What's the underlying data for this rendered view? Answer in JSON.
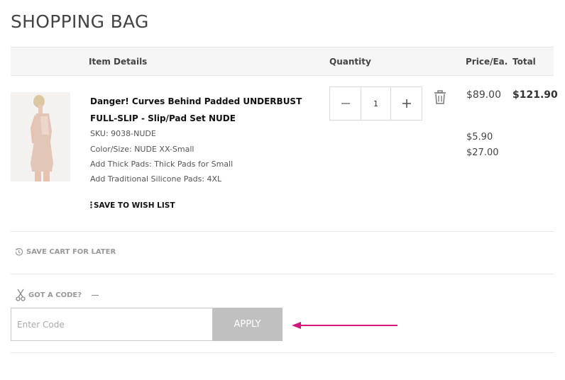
{
  "page": {
    "title": "SHOPPING BAG"
  },
  "table_header": {
    "item_details": "Item Details",
    "quantity": "Quantity",
    "price_each": "Price/Ea.",
    "total": "Total"
  },
  "item": {
    "name": "Danger! Curves Behind Padded UNDERBUST FULL-SLIP - Slip/Pad Set NUDE",
    "sku": "SKU: 9038-NUDE",
    "color_size": "Color/Size: NUDE XX-Small",
    "thick_pads": "Add Thick Pads: Thick Pads for Small",
    "silicone_pads": "Add Traditional Silicone Pads: 4XL",
    "wish_list": "SAVE TO WISH LIST",
    "quantity": "1",
    "price": "$89.00",
    "total": "$121.90",
    "addon_price_1": "$5.90",
    "addon_price_2": "$27.00"
  },
  "save_cart": {
    "label": "SAVE CART FOR LATER"
  },
  "promo": {
    "toggle_label": "GOT A CODE?",
    "placeholder": "Enter Code",
    "apply_label": "APPLY"
  },
  "colors": {
    "arrow": "#d6157d",
    "apply_bg": "#c0c0c0",
    "header_bg": "#f7f6f6"
  },
  "icons": {
    "minus": "minus-icon",
    "plus": "plus-icon",
    "trash": "trash-icon",
    "history": "history-icon",
    "scissors": "scissors-icon",
    "wish_list_dots": "kebab-icon"
  }
}
